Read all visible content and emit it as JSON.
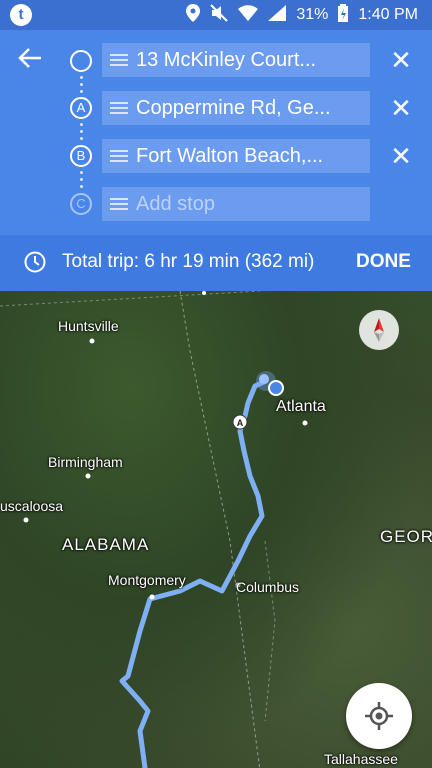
{
  "status_bar": {
    "app_icon": "t",
    "battery_percent": "31%",
    "time": "1:40 PM",
    "icons": [
      "location-icon",
      "mute-icon",
      "wifi-icon",
      "signal-icon",
      "battery-icon"
    ]
  },
  "route": {
    "stops": [
      {
        "marker": "",
        "text": "13 McKinley Court..."
      },
      {
        "marker": "A",
        "text": "Coppermine Rd, Ge..."
      },
      {
        "marker": "B",
        "text": "Fort Walton Beach,..."
      }
    ],
    "add_stop": {
      "marker": "C",
      "placeholder": "Add stop"
    }
  },
  "trip": {
    "summary": "Total trip: 6 hr 19 min  (362 mi)",
    "done_label": "DONE"
  },
  "map": {
    "labels": {
      "huntsville": "Huntsville",
      "atlanta": "Atlanta",
      "birmingham": "Birmingham",
      "tuscaloosa": "uscaloosa",
      "alabama": "ALABAMA",
      "georgia": "GEOR",
      "montgomery": "Montgomery",
      "columbus": "Columbus",
      "tallahassee": "Tallahassee"
    },
    "route_marker": "A"
  },
  "colors": {
    "header": "#4a86e8",
    "status_bar": "#3b6fd0",
    "trip_bar": "#3e7ae0",
    "route_line": "#7fb0f5"
  }
}
